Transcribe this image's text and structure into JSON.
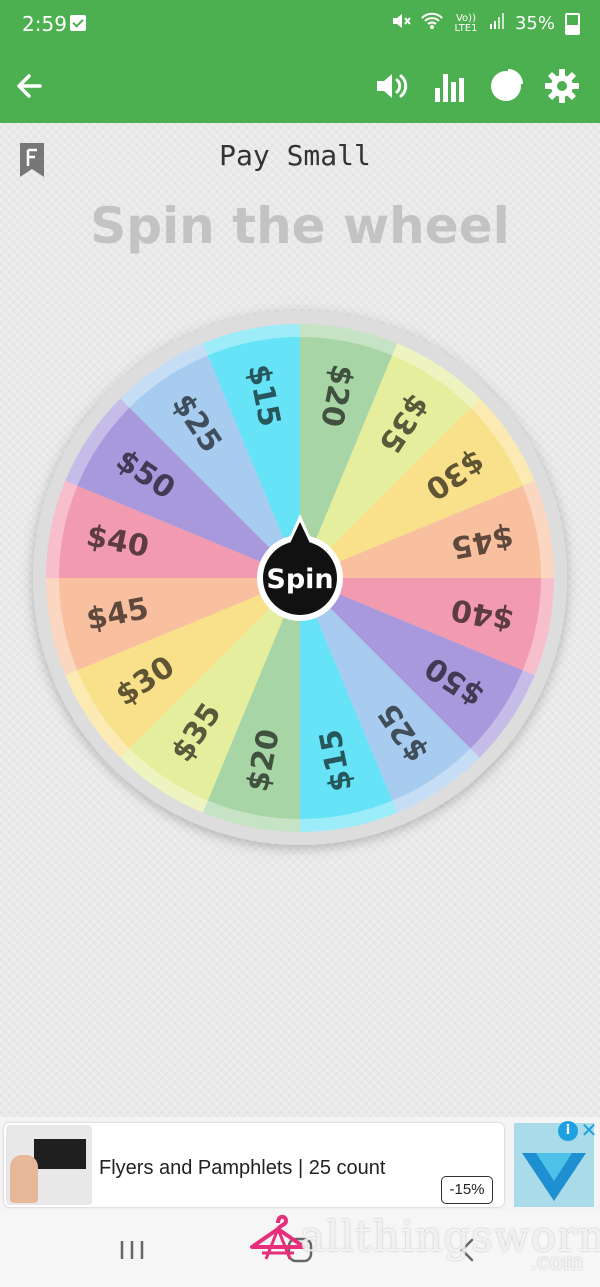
{
  "status_bar": {
    "time": "2:59",
    "network": "Vo)) LTE1",
    "battery": "35%"
  },
  "app_bar": {
    "icons": [
      "back-arrow-icon",
      "volume-icon",
      "bar-chart-icon",
      "pie-chart-icon",
      "settings-gear-icon"
    ],
    "accent": "#4caf50"
  },
  "wheel": {
    "name": "Pay Small",
    "title": "Spin the wheel",
    "spin_label": "Spin",
    "slices": [
      {
        "label": "$20",
        "color": "#a8d5a6"
      },
      {
        "label": "$35",
        "color": "#e4ee9c"
      },
      {
        "label": "$30",
        "color": "#f9e08a"
      },
      {
        "label": "$45",
        "color": "#f9c0a0"
      },
      {
        "label": "$40",
        "color": "#f29bb0"
      },
      {
        "label": "$50",
        "color": "#a898dc"
      },
      {
        "label": "$25",
        "color": "#a8ccef"
      },
      {
        "label": "$15",
        "color": "#66e3f6"
      },
      {
        "label": "$20",
        "color": "#a8d5a6"
      },
      {
        "label": "$35",
        "color": "#e4ee9c"
      },
      {
        "label": "$30",
        "color": "#f9e08a"
      },
      {
        "label": "$45",
        "color": "#f9c0a0"
      },
      {
        "label": "$40",
        "color": "#f29bb0"
      },
      {
        "label": "$50",
        "color": "#a898dc"
      },
      {
        "label": "$25",
        "color": "#a8ccef"
      },
      {
        "label": "$15",
        "color": "#66e3f6"
      }
    ]
  },
  "ad": {
    "text": "Flyers and Pamphlets | 25 count",
    "badge": "-15%",
    "info_icon": "info-icon",
    "close_icon": "close-icon"
  },
  "nav_bar": {
    "icons": [
      "recent-apps-icon",
      "home-icon",
      "back-icon"
    ]
  },
  "watermark": {
    "text": "allthingsworn",
    "sub": ".com"
  }
}
